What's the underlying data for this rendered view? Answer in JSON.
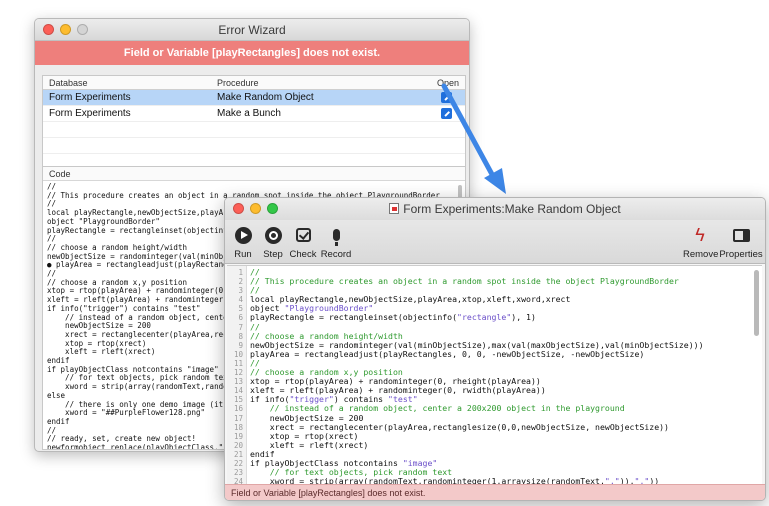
{
  "wizard": {
    "title": "Error Wizard",
    "error_message": "Field or Variable [playRectangles] does not exist.",
    "columns": [
      "Database",
      "Procedure",
      "Open"
    ],
    "rows": [
      {
        "database": "Form Experiments",
        "procedure": "Make Random Object",
        "selected": true
      },
      {
        "database": "Form Experiments",
        "procedure": "Make a Bunch",
        "selected": false
      }
    ],
    "code_label": "Code",
    "code_text": "//\n// This procedure creates an object in a random spot inside the object PlaygroundBorder\n//\nlocal playRectangle,newObjectSize,playArea,xt\nobject \"PlaygroundBorder\"\nplayRectangle = rectangleinset(objectinfo(\"r\n//\n// choose a random height/width\nnewObjectSize = randominteger(val(minObjectSi\n● playArea = rectangleadjust(playRectangles, 0\n//\n// choose a random x,y position\nxtop = rtop(playArea) + randominteger(0, rhei\nxleft = rleft(playArea) + randominteger(0, r\nif info(\"trigger\") contains \"test\"\n    // instead of a random object, center a\n    newObjectSize = 200\n    xrect = rectanglecenter(playArea,rectang\n    xtop = rtop(xrect)\n    xleft = rleft(xrect)\nendif\nif playObjectClass notcontains \"image\"\n    // for text objects, pick random text\n    xword = strip(array(randomText,randomi\nelse\n    // there is only one demo image (it's bu\n    xword = \"##PurpleFlower128.png\"\nendif\n//\n// ready, set, create new object!\nnewformobject replace(playObjectClass,\" \",\"\n    \"name\",?(info(\"trigger\") contains \"test\n    \"rectangle\",rectanglesize(xtop, xleft, n\n    ..."
  },
  "editor": {
    "title": "Form Experiments:Make Random Object",
    "toolbar": {
      "run": "Run",
      "step": "Step",
      "check": "Check",
      "record": "Record",
      "remove": "Remove",
      "properties": "Properties"
    },
    "line_numbers": "1\n2\n3\n4\n5\n6\n7\n8\n9\n10\n11\n12\n13\n14\n15\n16\n17\n18\n19\n20\n21\n22\n23\n24",
    "lines": {
      "l1": "//",
      "l2": "// This procedure creates an object in a random spot inside the object PlaygroundBorder",
      "l3": "//",
      "l4": "local playRectangle,newObjectSize,playArea,xtop,xleft,xword,xrect",
      "l5a": "object ",
      "l5b": "\"PlaygroundBorder\"",
      "l6a": "playRectangle = rectangleinset(objectinfo(",
      "l6b": "\"rectangle\"",
      "l6c": "), 1)",
      "l7": "//",
      "l8": "// choose a random height/width",
      "l9": "newObjectSize = randominteger(val(minObjectSize),max(val(maxObjectSize),val(minObjectSize)))",
      "l10": "playArea = rectangleadjust(playRectangles, 0, 0, -newObjectSize, -newObjectSize)",
      "l11": "//",
      "l12": "// choose a random x,y position",
      "l13": "xtop = rtop(playArea) + randominteger(0, rheight(playArea))",
      "l14": "xleft = rleft(playArea) + randominteger(0, rwidth(playArea))",
      "l15a": "if info(",
      "l15b": "\"trigger\"",
      "l15c": ") contains ",
      "l15d": "\"test\"",
      "l16": "    // instead of a random object, center a 200x200 object in the playground",
      "l17": "    newObjectSize = 200",
      "l18": "    xrect = rectanglecenter(playArea,rectanglesize(0,0,newObjectSize, newObjectSize))",
      "l19": "    xtop = rtop(xrect)",
      "l20": "    xleft = rleft(xrect)",
      "l21": "endif",
      "l22a": "if playObjectClass notcontains ",
      "l22b": "\"image\"",
      "l23": "    // for text objects, pick random text",
      "l24a": "    xword = strip(array(randomText,randominteger(1,arraysize(randomText,",
      "l24b": "\",\"",
      "l24c": ")),",
      "l24d": "\",\"",
      "l24e": "))"
    },
    "status": "Field or Variable [playRectangles] does not exist."
  },
  "colors": {
    "error_bar": "#ee7f7c",
    "selection": "#b7d5f7",
    "arrow": "#3d86e6",
    "comment": "#2f9a2f",
    "string": "#6b4fc9",
    "status_bar": "#f3c9c9"
  }
}
